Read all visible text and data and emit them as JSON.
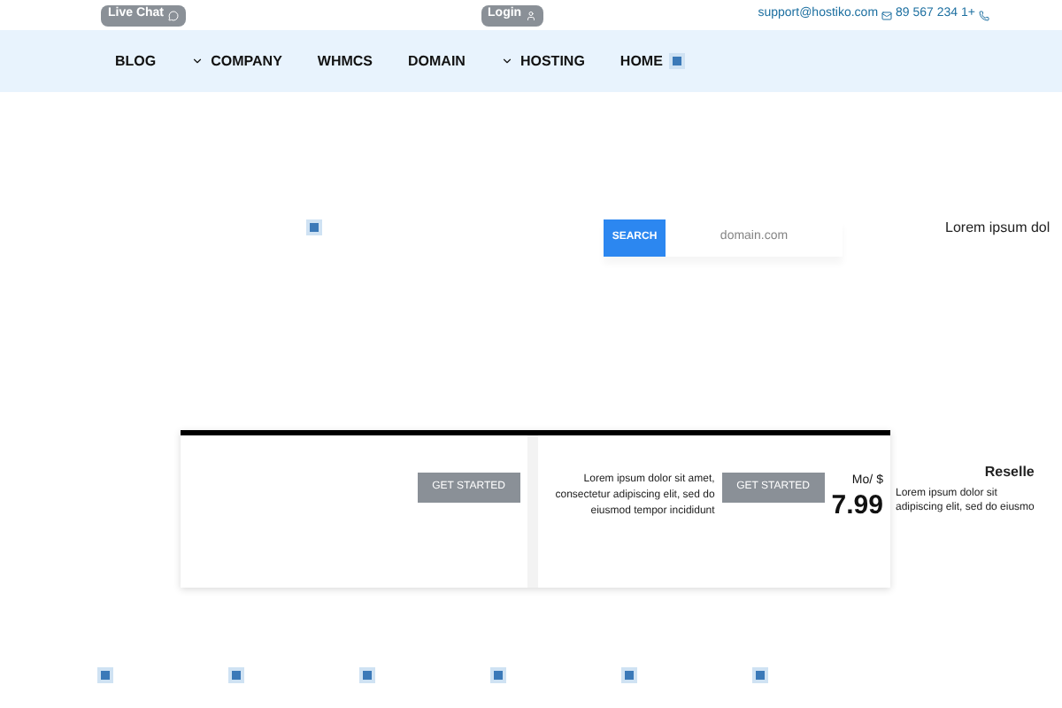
{
  "top_bar": {
    "live_chat": "Live Chat",
    "login": "Login",
    "email": "support@hostiko.com",
    "phone": "89 567 234 1+"
  },
  "nav": {
    "items": [
      {
        "label": "BLOG",
        "kind": "plain"
      },
      {
        "label": "COMPANY",
        "kind": "dropdown"
      },
      {
        "label": "WHMCS",
        "kind": "plain"
      },
      {
        "label": "DOMAIN",
        "kind": "plain"
      },
      {
        "label": "HOSTING",
        "kind": "dropdown"
      },
      {
        "label": "HOME",
        "kind": "image"
      }
    ]
  },
  "hero": {
    "search_button": "SEARCH",
    "domain_placeholder": "domain.com",
    "side_text": "Lorem ipsum dol"
  },
  "plans": [
    {
      "button": "GET STARTED"
    },
    {
      "description": "Lorem ipsum dolor sit amet, consectetur adipiscing elit, sed do eiusmod tempor incididunt",
      "button": "GET STARTED",
      "period": "Mo/",
      "currency": "$",
      "price": "7.99"
    }
  ],
  "overflow_plan": {
    "title": "Reselle",
    "lines": [
      "Lorem ipsum dolor sit",
      "adipiscing elit, sed do eiusmo"
    ]
  }
}
